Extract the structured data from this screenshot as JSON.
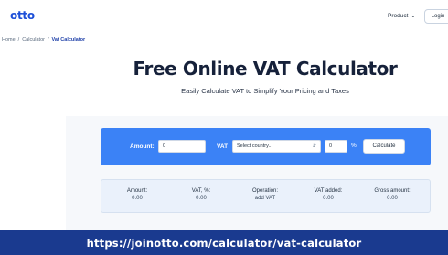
{
  "header": {
    "logo": "otto",
    "product_menu": "Product",
    "login_label": "Login"
  },
  "breadcrumb": [
    "Home",
    "/",
    "Calculator",
    "/",
    "Vat Calculator"
  ],
  "hero": {
    "title": "Free Online VAT Calculator",
    "subtitle": "Easily Calculate VAT to Simplify Your Pricing and Taxes"
  },
  "form": {
    "amount_label": "Amount:",
    "amount_value": "0",
    "vat_label": "VAT",
    "country_placeholder": "Select country...",
    "rate_value": "0",
    "percent_label": "%",
    "calculate_label": "Calculate"
  },
  "results": {
    "columns": [
      {
        "label": "Amount:",
        "value": "0.00"
      },
      {
        "label": "VAT, %:",
        "value": "0.00"
      },
      {
        "label": "Operation:",
        "value": "add VAT"
      },
      {
        "label": "VAT added:",
        "value": "0.00"
      },
      {
        "label": "Gross amount:",
        "value": "0.00"
      }
    ]
  },
  "banner": {
    "url": "https://joinotto.com/calculator/vat-calculator"
  },
  "colors": {
    "brand": "#1d4fd8",
    "form_bar": "#3b82f6",
    "banner": "#1a3a8f",
    "results_bg": "#eaf1fb"
  },
  "icons": {
    "product_menu": "chevron-down-icon",
    "country_select": "updown-arrows-icon"
  }
}
